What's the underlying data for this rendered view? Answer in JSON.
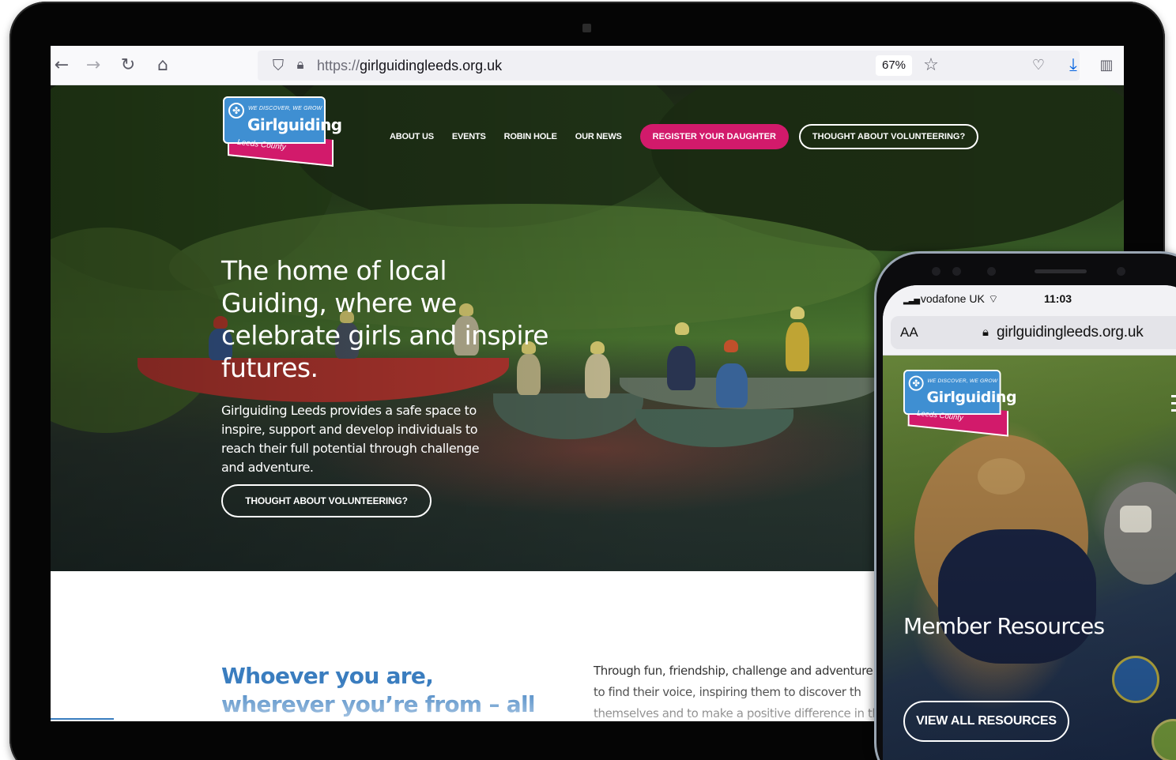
{
  "browser": {
    "url_scheme": "https://",
    "url_host": "girlguidingleeds.org.uk",
    "zoom": "67%",
    "icons": [
      "back-icon",
      "forward-icon",
      "reload-icon",
      "home-icon",
      "shield-icon",
      "lock-icon",
      "star-icon",
      "pocket-icon",
      "download-icon",
      "reader-icon"
    ]
  },
  "site": {
    "logo": {
      "tagline": "WE DISCOVER, WE GROW",
      "name": "Girlguiding",
      "county": "Leeds County"
    },
    "nav": {
      "items": [
        "ABOUT US",
        "EVENTS",
        "ROBIN HOLE",
        "OUR NEWS"
      ],
      "register_label": "REGISTER YOUR DAUGHTER",
      "volunteer_label": "THOUGHT ABOUT VOLUNTEERING?"
    },
    "hero": {
      "title": "The home of local Guiding, where we celebrate girls and inspire futures.",
      "body": "Girlguiding Leeds provides a safe space to inspire, support and develop individuals to reach their full potential through challenge and adventure.",
      "cta": "THOUGHT ABOUT VOLUNTEERING?"
    },
    "intro": {
      "heading": "Whoever you are, wherever you’re from – all girls are",
      "body": "Through fun, friendship, challenge and adventure w girls to find their voice, inspiring them to discover th themselves and to make a positive difference in the"
    }
  },
  "phone": {
    "carrier": "vodafone UK",
    "time": "11:03",
    "text_size_label": "AA",
    "url": "girlguidingleeds.org.uk",
    "logo": {
      "tagline": "WE DISCOVER, WE GROW",
      "name": "Girlguiding",
      "county": "Leeds County"
    },
    "hero_title": "Member Resources",
    "cta": "VIEW ALL RESOURCES"
  },
  "colors": {
    "brand_pink": "#d21a6b",
    "brand_blue": "#3f8fd2",
    "heading_blue": "#3a7dbf"
  }
}
